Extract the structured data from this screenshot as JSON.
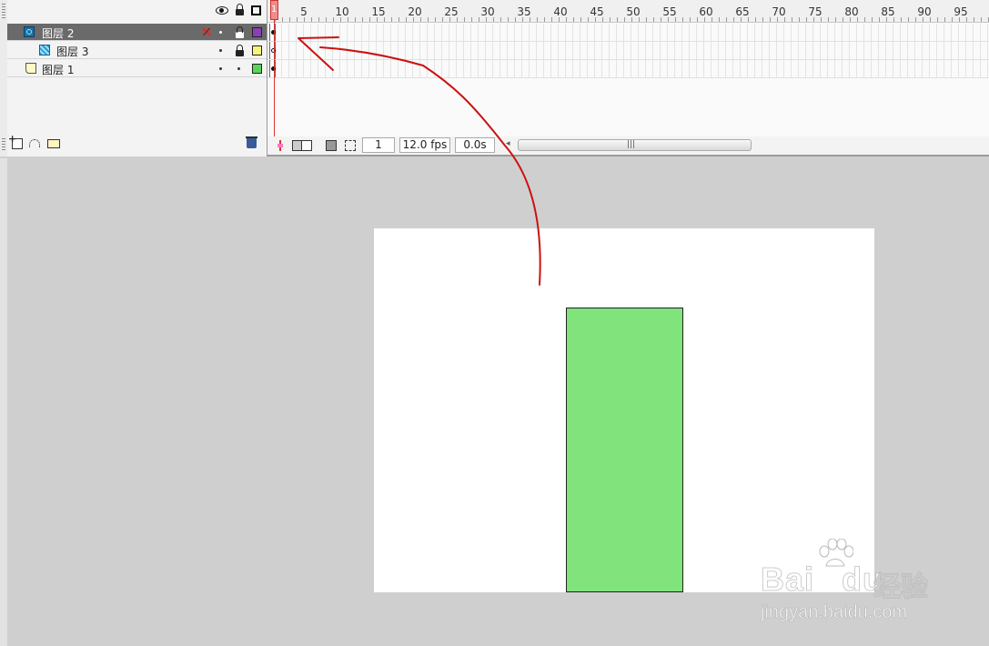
{
  "layers": [
    {
      "name": "图层 2",
      "type": "guide",
      "selected": true,
      "outline_color": "#8a3fb6"
    },
    {
      "name": "图层 3",
      "type": "guided",
      "selected": false,
      "outline_color": "#f4f47a"
    },
    {
      "name": "图层 1",
      "type": "normal",
      "selected": false,
      "outline_color": "#58d458"
    }
  ],
  "timeline": {
    "ruler_labels": [
      "1",
      "5",
      "10",
      "15",
      "20",
      "25",
      "30",
      "35",
      "40",
      "45",
      "50",
      "55",
      "60",
      "65",
      "70",
      "75",
      "80",
      "85",
      "90",
      "95"
    ],
    "current_frame": "1",
    "frame_rate": "12.0 fps",
    "elapsed_time": "0.0s"
  },
  "stage": {
    "background_color": "#ffffff",
    "shape_fill_color": "#80e37c"
  },
  "watermark": {
    "logo_text": "Bai",
    "logo_text_tail": "du",
    "cn_text": "经验",
    "url": "jingyan.baidu.com"
  },
  "annotation_color": "#cc1111"
}
